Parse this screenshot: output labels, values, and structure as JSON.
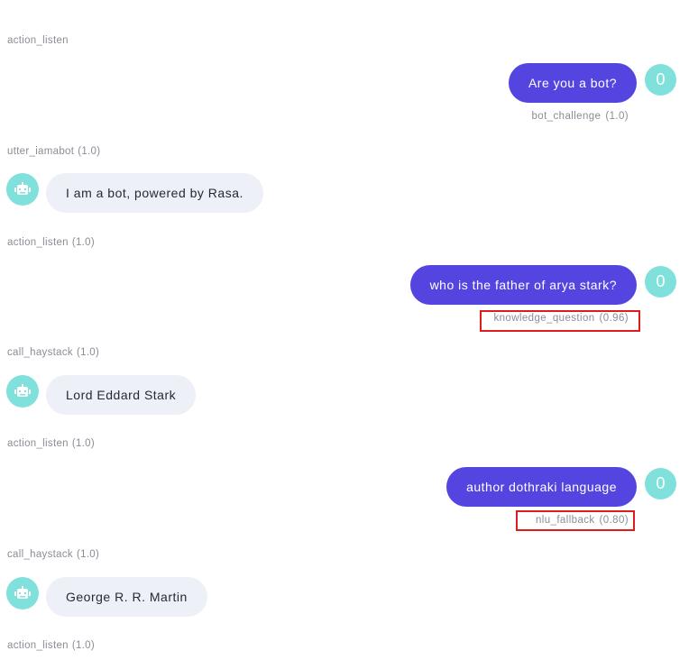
{
  "conversation": [
    {
      "type": "action",
      "name": "action_listen",
      "confidence": ""
    },
    {
      "type": "user",
      "text": "Are you a bot?",
      "avatar": "0",
      "intent": "bot_challenge",
      "intent_confidence": "(1.0)",
      "highlighted": false
    },
    {
      "type": "action",
      "name": "utter_iamabot",
      "confidence": "(1.0)"
    },
    {
      "type": "bot",
      "text": "I am a bot, powered by Rasa.",
      "icon": "robot-icon"
    },
    {
      "type": "action",
      "name": "action_listen",
      "confidence": "(1.0)"
    },
    {
      "type": "user",
      "text": "who is the father of arya stark?",
      "avatar": "0",
      "intent": "knowledge_question",
      "intent_confidence": "(0.96)",
      "highlighted": true
    },
    {
      "type": "action",
      "name": "call_haystack",
      "confidence": "(1.0)"
    },
    {
      "type": "bot",
      "text": "Lord Eddard Stark",
      "icon": "robot-icon"
    },
    {
      "type": "action",
      "name": "action_listen",
      "confidence": "(1.0)"
    },
    {
      "type": "user",
      "text": "author dothraki language",
      "avatar": "0",
      "intent": "nlu_fallback",
      "intent_confidence": "(0.80)",
      "highlighted": true
    },
    {
      "type": "action",
      "name": "call_haystack",
      "confidence": "(1.0)"
    },
    {
      "type": "bot",
      "text": "George R. R. Martin",
      "icon": "robot-icon"
    },
    {
      "type": "action",
      "name": "action_listen",
      "confidence": "(1.0)"
    }
  ],
  "colors": {
    "user_bubble": "#5545e0",
    "bot_bubble": "#eef0f8",
    "avatar": "#7fe0dc",
    "highlight_border": "#e01b1b",
    "meta_text": "#8a8d96"
  }
}
